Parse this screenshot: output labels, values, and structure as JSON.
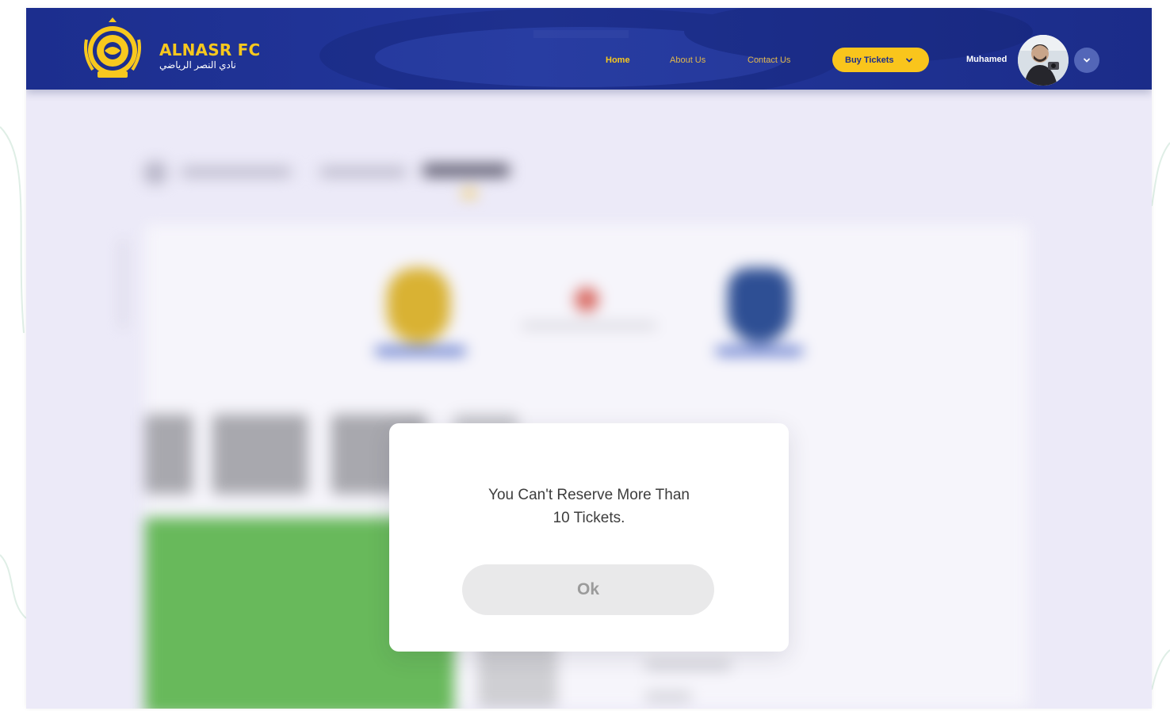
{
  "brand": {
    "title": "ALNASR FC",
    "subtitle": "نادي النصر الرياضي"
  },
  "nav": {
    "home": "Home",
    "about": "About Us",
    "contact": "Contact Us",
    "buy_tickets": "Buy Tickets"
  },
  "user": {
    "name": "Muhamed"
  },
  "dialog": {
    "message_line1": "You Can't Reserve More Than",
    "message_line2": "10 Tickets.",
    "ok_label": "Ok"
  },
  "colors": {
    "header_blue": "#1c2e8e",
    "accent_yellow": "#f9c51c",
    "page_bg": "#eceaf8",
    "pitch_green": "#68b95b"
  },
  "icons": {
    "buy_tickets_toggle": "chevron-down-icon",
    "user_menu_toggle": "chevron-down-icon"
  }
}
